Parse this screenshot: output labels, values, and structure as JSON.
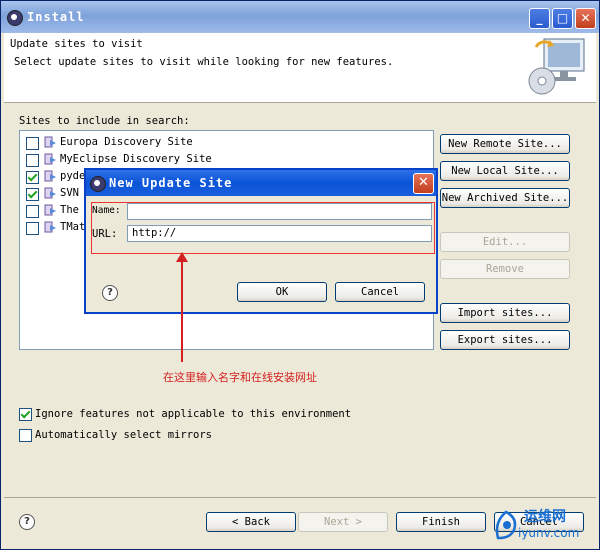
{
  "window": {
    "title": "Install"
  },
  "banner": {
    "title": "Update sites to visit",
    "subtitle": "Select update sites to visit while looking for new features."
  },
  "sites": {
    "label": "Sites to include in search:",
    "items": [
      {
        "label": "Europa Discovery Site",
        "checked": false
      },
      {
        "label": "MyEclipse Discovery Site",
        "checked": false
      },
      {
        "label": "pyde",
        "checked": true
      },
      {
        "label": "SVN",
        "checked": true
      },
      {
        "label": "The",
        "checked": false
      },
      {
        "label": "TMat",
        "checked": false
      }
    ]
  },
  "side_buttons": {
    "new_remote": "New Remote Site...",
    "new_local": "New Local Site...",
    "new_archived": "New Archived Site...",
    "edit": "Edit...",
    "remove": "Remove",
    "import": "Import sites...",
    "export": "Export sites..."
  },
  "options": {
    "ignore_label": "Ignore features not applicable to this environment",
    "ignore_checked": true,
    "mirrors_label": "Automatically select mirrors",
    "mirrors_checked": false
  },
  "footer": {
    "back": "< Back",
    "next": "Next >",
    "finish": "Finish",
    "cancel": "Cancel"
  },
  "dialog": {
    "title": "New Update Site",
    "name_label": "Name:",
    "name_value": "",
    "url_label": "URL:",
    "url_value": "http://",
    "ok": "OK",
    "cancel": "Cancel"
  },
  "annotation": {
    "text": "在这里输入名字和在线安装网址",
    "color": "#d42020"
  },
  "watermark": {
    "cn": "运维网",
    "en": "iyunv.com"
  },
  "colors": {
    "accent": "#0842c8",
    "title_bar": "#7da2da"
  }
}
